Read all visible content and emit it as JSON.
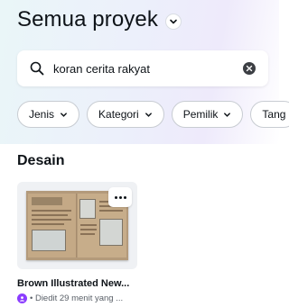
{
  "header": {
    "title": "Semua proyek"
  },
  "search": {
    "value": "koran cerita rakyat"
  },
  "filters": [
    {
      "label": "Jenis"
    },
    {
      "label": "Kategori"
    },
    {
      "label": "Pemilik"
    },
    {
      "label": "Tang"
    }
  ],
  "section": {
    "title": "Desain"
  },
  "designs": [
    {
      "title": "Brown Illustrated New...",
      "meta": "• Diedit 29 menit yang ...",
      "thumbnail": {
        "left_heading": "Hortis Rakyat Padi Bersinar",
        "right_heading": "Cerita Rakyat"
      }
    }
  ],
  "colors": {
    "accent": "#8b3dff",
    "text": "#0e1318"
  }
}
